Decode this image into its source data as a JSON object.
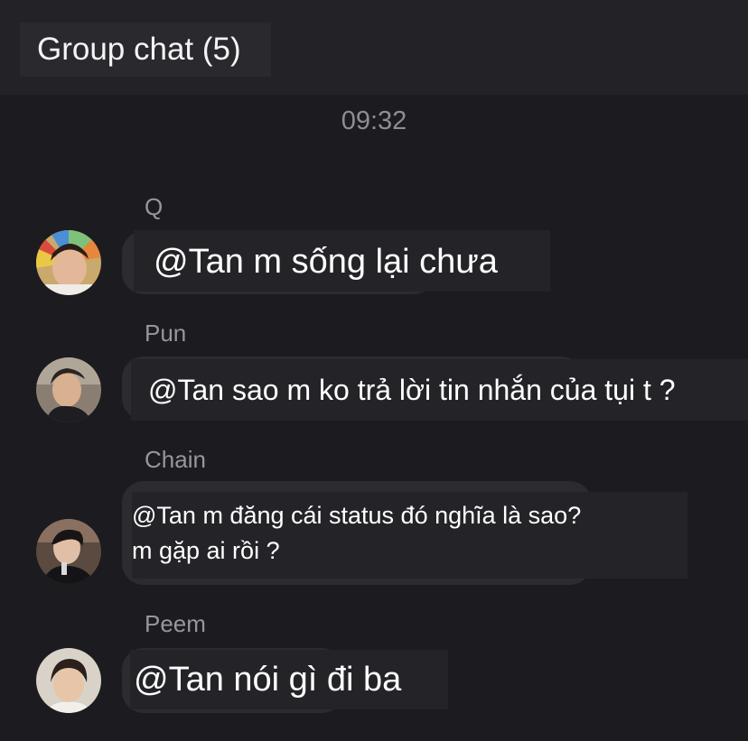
{
  "header": {
    "title": "Group chat (5)"
  },
  "timestamp": "09:32",
  "messages": [
    {
      "sender": "Q",
      "text": "@Tan m sống lại chưa"
    },
    {
      "sender": "Pun",
      "text": "@Tan sao m ko trả lời tin nhắn của tụi t ?"
    },
    {
      "sender": "Chain",
      "lines": [
        "@Tan m đăng cái status đó nghĩa là sao?",
        "m gặp ai rồi ?"
      ]
    },
    {
      "sender": "Peem",
      "text": "@Tan nói gì đi ba"
    }
  ]
}
